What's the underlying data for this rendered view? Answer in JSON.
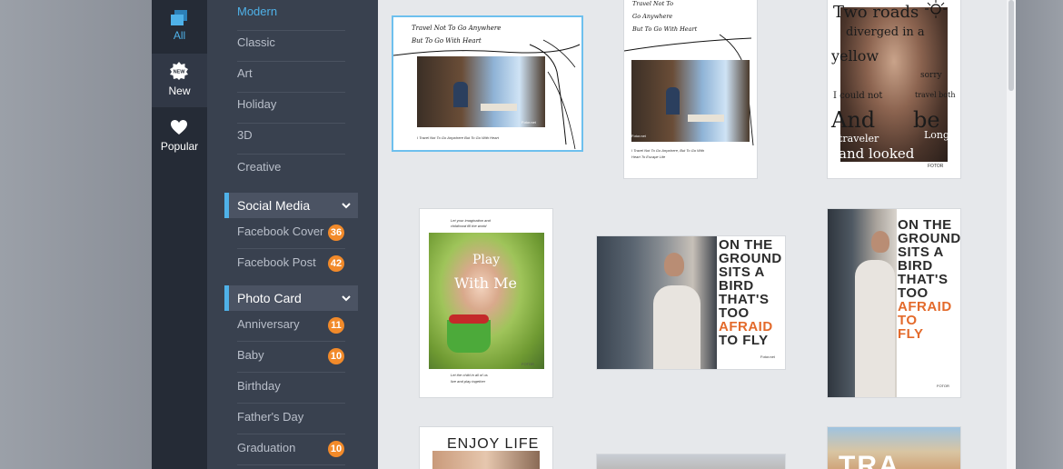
{
  "rail": {
    "items": [
      {
        "label": "All",
        "icon": "layers-icon",
        "active": true
      },
      {
        "label": "New",
        "icon": "new-badge-icon",
        "active": false
      },
      {
        "label": "Popular",
        "icon": "heart-icon",
        "active": false
      }
    ]
  },
  "categories": {
    "top": [
      "Modern",
      "Classic",
      "Art",
      "Holiday",
      "3D",
      "Creative"
    ],
    "social_media": {
      "title": "Social Media",
      "items": [
        {
          "label": "Facebook Cover",
          "badge": "36"
        },
        {
          "label": "Facebook Post",
          "badge": "42"
        }
      ]
    },
    "photo_card": {
      "title": "Photo Card",
      "items": [
        {
          "label": "Anniversary",
          "badge": "11"
        },
        {
          "label": "Baby",
          "badge": "10"
        },
        {
          "label": "Birthday",
          "badge": ""
        },
        {
          "label": "Father's Day",
          "badge": ""
        },
        {
          "label": "Graduation",
          "badge": "10"
        }
      ]
    }
  },
  "colors": {
    "accent": "#4fb1e8",
    "badge": "#f28a2a",
    "rail_bg": "#252b36",
    "panel_bg": "#39414f",
    "gallery_bg": "#e6e8eb"
  },
  "templates": {
    "t1": {
      "title_line1": "Travel Not To Go Anywhere",
      "title_line2": "But To Go With Heart",
      "caption": "I Travel Not To Go Anywhere But To Go With Heart",
      "brand": "Fotor.net"
    },
    "t2": {
      "title_line1": "Travel Not To",
      "title_line2": "Go Anywhere",
      "title_line3": "But To Go With Heart",
      "caption_line1": "I Travel Not To Go Anywhere, But To Go With",
      "caption_line2": "Heart To Escape Life",
      "brand": "Fotor.net"
    },
    "t3": {
      "words": [
        "Two roads",
        "diverged in a",
        "yellow",
        "sorry",
        "I could not",
        "travel both",
        "And",
        "be",
        "traveler",
        "Long",
        "and looked"
      ],
      "brand": "FOTOR"
    },
    "t4": {
      "top_line1": "Let your imagination and",
      "top_line2": "childhood fill the world",
      "overlay_line1": "Play",
      "overlay_line2": "With Me",
      "bottom_line1": "Let the child in all of us",
      "bottom_line2": "live and play together",
      "brand": "FOTOR"
    },
    "t5": {
      "lines": [
        "ON THE",
        "GROUND",
        "SITS A",
        "BIRD",
        "THAT'S",
        "TOO",
        "AFRAID",
        "TO FLY"
      ],
      "brand": "Fotor.net"
    },
    "t6": {
      "lines": [
        "ON THE",
        "GROUND",
        "SITS A",
        "BIRD",
        "THAT'S",
        "TOO",
        "AFRAID",
        "TO",
        "FLY"
      ],
      "brand": "FOTOR"
    },
    "t7": {
      "title": "ENJOY LIFE"
    },
    "t9": {
      "title": "TRA"
    }
  }
}
